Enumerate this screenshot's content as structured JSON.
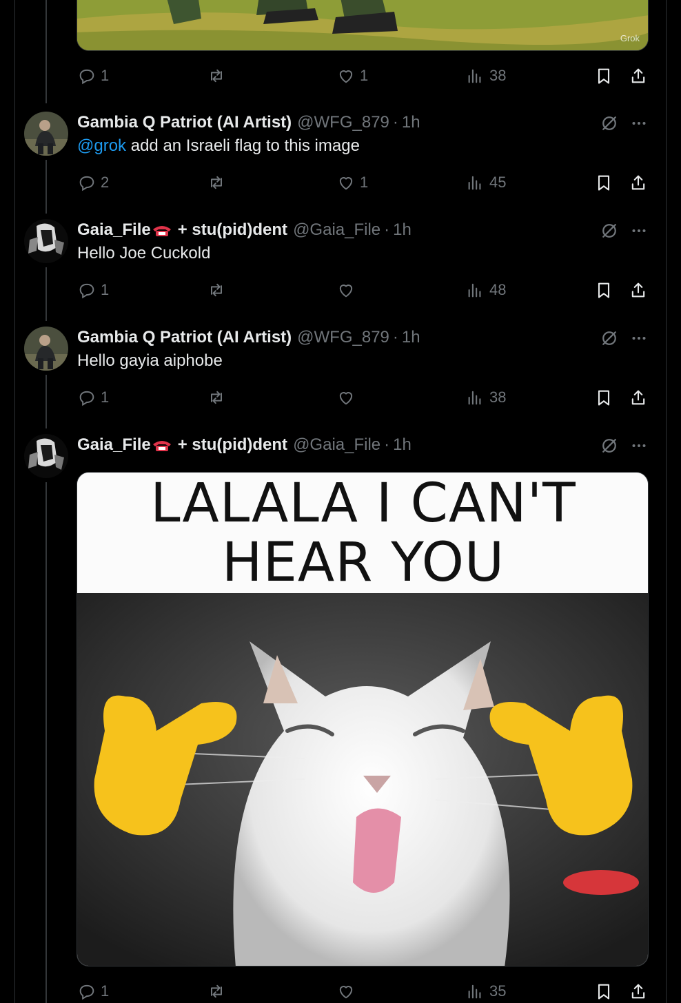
{
  "top_image": {
    "watermark": "Grok"
  },
  "top_actions": {
    "replies": "1",
    "reposts": "",
    "likes": "1",
    "views": "38"
  },
  "posts": [
    {
      "author": "Gambia Q Patriot (AI Artist)",
      "handle": "@WFG_879",
      "time": "1h",
      "mention": "@grok",
      "text": " add an Israeli flag to this image",
      "replies": "2",
      "reposts": "",
      "likes": "1",
      "views": "45"
    },
    {
      "author": "Gaia_File",
      "author_suffix": "+ stu(pid)dent",
      "handle": "@Gaia_File",
      "time": "1h",
      "text": "Hello Joe Cuckold",
      "replies": "1",
      "reposts": "",
      "likes": "",
      "views": "48"
    },
    {
      "author": "Gambia Q Patriot (AI Artist)",
      "handle": "@WFG_879",
      "time": "1h",
      "text": "Hello gayia aiphobe",
      "replies": "1",
      "reposts": "",
      "likes": "",
      "views": "38"
    },
    {
      "author": "Gaia_File",
      "author_suffix": "+ stu(pid)dent",
      "handle": "@Gaia_File",
      "time": "1h",
      "image_caption_line1": "LALALA I CAN'T",
      "image_caption_line2": "HEAR YOU",
      "replies": "1",
      "reposts": "",
      "likes": "",
      "views": "35"
    }
  ],
  "separator": "·",
  "colors": {
    "background": "#000000",
    "text": "#e7e9ea",
    "muted": "#71767b",
    "link": "#1d9bf0"
  },
  "icons": [
    "reply-icon",
    "repost-icon",
    "like-icon",
    "views-icon",
    "bookmark-icon",
    "share-icon",
    "grok-icon",
    "more-icon"
  ]
}
